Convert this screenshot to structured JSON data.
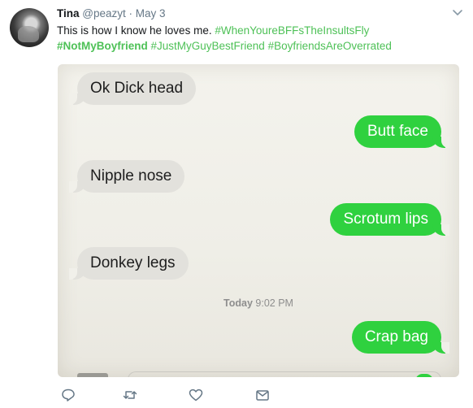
{
  "tweet": {
    "author_name": "Tina",
    "author_handle": "@peazyt",
    "separator": "·",
    "date": "May 3",
    "text_plain": "This is how I know he loves me. ",
    "hashtags_line1": "#WhenYoureBFFsTheInsultsFly",
    "hashtag_bold": "#NotMyBoyfriend",
    "hashtags_line2": " #JustMyGuyBestFriend #BoyfriendsAreOverrated"
  },
  "messages": [
    {
      "direction": "in",
      "text": "Ok Dick head"
    },
    {
      "direction": "out",
      "text": "Butt face"
    },
    {
      "direction": "in",
      "text": "Nipple nose"
    },
    {
      "direction": "out",
      "text": "Scrotum lips"
    },
    {
      "direction": "in",
      "text": "Donkey legs"
    },
    {
      "direction": "out",
      "text": "Crap bag"
    }
  ],
  "timestamp": {
    "day": "Today",
    "time": " 9:02 PM"
  },
  "actions": [
    {
      "name": "reply-icon"
    },
    {
      "name": "retweet-icon"
    },
    {
      "name": "like-icon"
    },
    {
      "name": "direct-message-icon"
    }
  ],
  "colors": {
    "hashtag": "#4ec157",
    "sent_bubble": "#2fd13f",
    "received_bubble": "#e2e1dc",
    "meta_text": "#657786"
  }
}
